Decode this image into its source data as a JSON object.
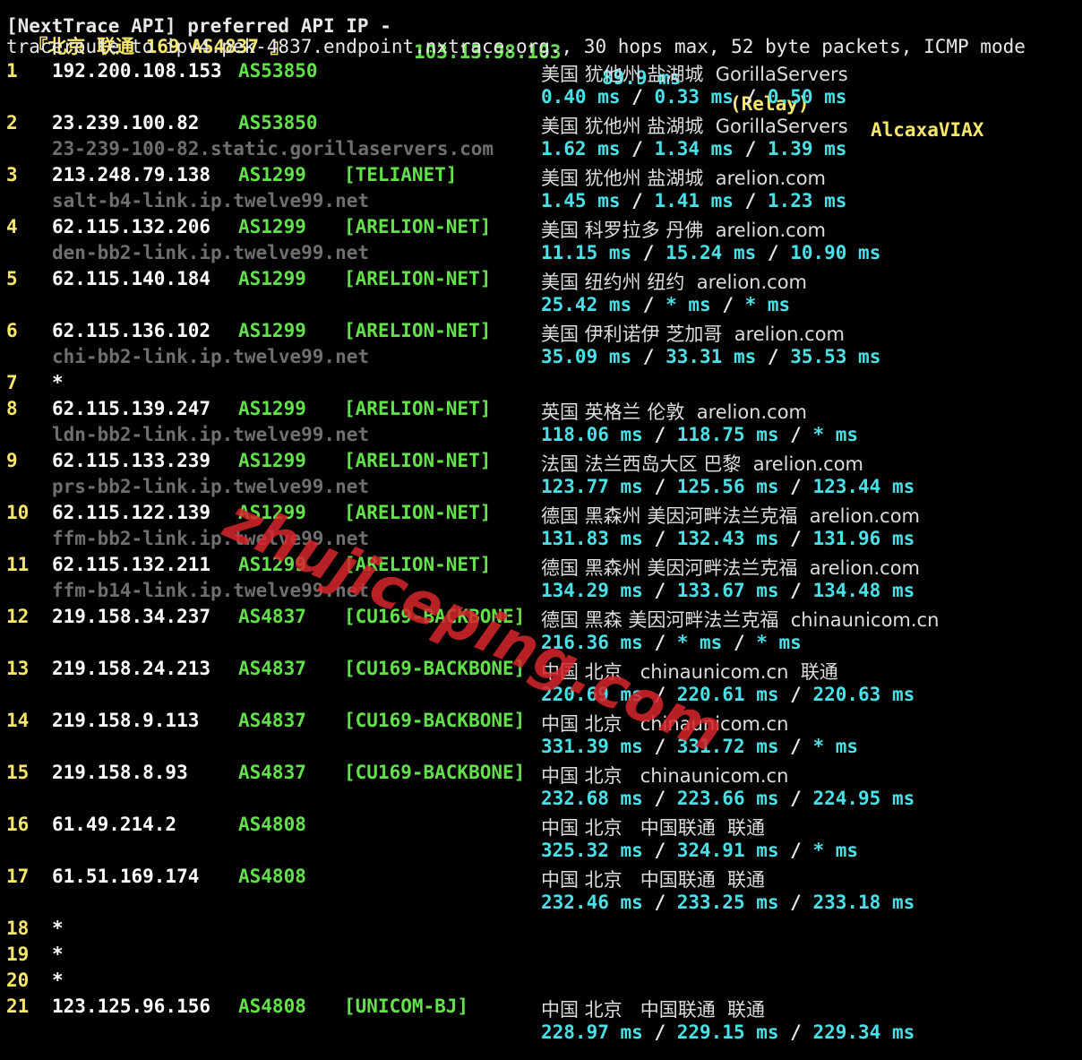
{
  "top_partial": {
    "left": "[NextTrace API] preferred API IP -",
    "ip": "103.13.98.103",
    "ms": "89.9 ms",
    "relay": "(Relay)",
    "tail": "AlcaxaVIAX"
  },
  "title": "『北京 联通 169 AS4837 』",
  "route_line": "traceroute to ipv4.pek-4837.endpoint.nxtrace.org., 30 hops max, 52 byte packets, ICMP mode",
  "watermark": "zhujiceping.com",
  "hops": [
    {
      "n": "1",
      "ip": "192.200.108.153",
      "as": "AS53850",
      "tag": "",
      "geo": "美国 犹他州 盐湖城  GorillaServers",
      "host": "",
      "lat": [
        "0.40 ms",
        "0.33 ms",
        "0.50 ms"
      ]
    },
    {
      "n": "2",
      "ip": "23.239.100.82",
      "as": "AS53850",
      "tag": "",
      "geo": "美国 犹他州 盐湖城  GorillaServers",
      "host": "23-239-100-82.static.gorillaservers.com",
      "lat": [
        "1.62 ms",
        "1.34 ms",
        "1.39 ms"
      ]
    },
    {
      "n": "3",
      "ip": "213.248.79.138",
      "as": "AS1299",
      "tag": "[TELIANET]",
      "geo": "美国 犹他州 盐湖城  arelion.com",
      "host": "salt-b4-link.ip.twelve99.net",
      "lat": [
        "1.45 ms",
        "1.41 ms",
        "1.23 ms"
      ]
    },
    {
      "n": "4",
      "ip": "62.115.132.206",
      "as": "AS1299",
      "tag": "[ARELION-NET]",
      "geo": "美国 科罗拉多 丹佛  arelion.com",
      "host": "den-bb2-link.ip.twelve99.net",
      "lat": [
        "11.15 ms",
        "15.24 ms",
        "10.90 ms"
      ]
    },
    {
      "n": "5",
      "ip": "62.115.140.184",
      "as": "AS1299",
      "tag": "[ARELION-NET]",
      "geo": "美国 纽约州 纽约  arelion.com",
      "host": "",
      "lat": [
        "25.42 ms",
        "* ms",
        "* ms"
      ]
    },
    {
      "n": "6",
      "ip": "62.115.136.102",
      "as": "AS1299",
      "tag": "[ARELION-NET]",
      "geo": "美国 伊利诺伊 芝加哥  arelion.com",
      "host": "chi-bb2-link.ip.twelve99.net",
      "lat": [
        "35.09 ms",
        "33.31 ms",
        "35.53 ms"
      ]
    },
    {
      "n": "7",
      "star": "*"
    },
    {
      "n": "8",
      "ip": "62.115.139.247",
      "as": "AS1299",
      "tag": "[ARELION-NET]",
      "geo": "英国 英格兰 伦敦  arelion.com",
      "host": "ldn-bb2-link.ip.twelve99.net",
      "lat": [
        "118.06 ms",
        "118.75 ms",
        "* ms"
      ]
    },
    {
      "n": "9",
      "ip": "62.115.133.239",
      "as": "AS1299",
      "tag": "[ARELION-NET]",
      "geo": "法国 法兰西岛大区 巴黎  arelion.com",
      "host": "prs-bb2-link.ip.twelve99.net",
      "lat": [
        "123.77 ms",
        "125.56 ms",
        "123.44 ms"
      ]
    },
    {
      "n": "10",
      "ip": "62.115.122.139",
      "as": "AS1299",
      "tag": "[ARELION-NET]",
      "geo": "德国 黑森州 美因河畔法兰克福  arelion.com",
      "host": "ffm-bb2-link.ip.twelve99.net",
      "lat": [
        "131.83 ms",
        "132.43 ms",
        "131.96 ms"
      ]
    },
    {
      "n": "11",
      "ip": "62.115.132.211",
      "as": "AS1299",
      "tag": "[ARELION-NET]",
      "geo": "德国 黑森州 美因河畔法兰克福  arelion.com",
      "host": "ffm-b14-link.ip.twelve99.net",
      "lat": [
        "134.29 ms",
        "133.67 ms",
        "134.48 ms"
      ]
    },
    {
      "n": "12",
      "ip": "219.158.34.237",
      "as": "AS4837",
      "tag": "[CU169-BACKBONE]",
      "geo": "德国 黑森 美因河畔法兰克福  chinaunicom.cn",
      "host": "",
      "lat": [
        "216.36 ms",
        "* ms",
        "* ms"
      ]
    },
    {
      "n": "13",
      "ip": "219.158.24.213",
      "as": "AS4837",
      "tag": "[CU169-BACKBONE]",
      "geo": "中国 北京   chinaunicom.cn  联通",
      "host": "",
      "lat": [
        "220.69 ms",
        "220.61 ms",
        "220.63 ms"
      ]
    },
    {
      "n": "14",
      "ip": "219.158.9.113",
      "as": "AS4837",
      "tag": "[CU169-BACKBONE]",
      "geo": "中国 北京   chinaunicom.cn",
      "host": "",
      "lat": [
        "331.39 ms",
        "331.72 ms",
        "* ms"
      ]
    },
    {
      "n": "15",
      "ip": "219.158.8.93",
      "as": "AS4837",
      "tag": "[CU169-BACKBONE]",
      "geo": "中国 北京   chinaunicom.cn",
      "host": "",
      "lat": [
        "232.68 ms",
        "223.66 ms",
        "224.95 ms"
      ]
    },
    {
      "n": "16",
      "ip": "61.49.214.2",
      "as": "AS4808",
      "tag": "",
      "geo": "中国 北京   中国联通  联通",
      "host": "",
      "lat": [
        "325.32 ms",
        "324.91 ms",
        "* ms"
      ]
    },
    {
      "n": "17",
      "ip": "61.51.169.174",
      "as": "AS4808",
      "tag": "",
      "geo": "中国 北京   中国联通  联通",
      "host": "",
      "lat": [
        "232.46 ms",
        "233.25 ms",
        "233.18 ms"
      ]
    },
    {
      "n": "18",
      "star": "*"
    },
    {
      "n": "19",
      "star": "*"
    },
    {
      "n": "20",
      "star": "*"
    },
    {
      "n": "21",
      "ip": "123.125.96.156",
      "as": "AS4808",
      "tag": "[UNICOM-BJ]",
      "geo": "中国 北京   中国联通  联通",
      "host": "",
      "lat": [
        "228.97 ms",
        "229.15 ms",
        "229.34 ms"
      ]
    }
  ],
  "colors": {
    "hop": "#f6e66a",
    "ip": "#ffffff",
    "as": "#63e14b",
    "host": "#6f6f6f",
    "latency": "#49e0e8",
    "watermark": "#d8262c"
  }
}
